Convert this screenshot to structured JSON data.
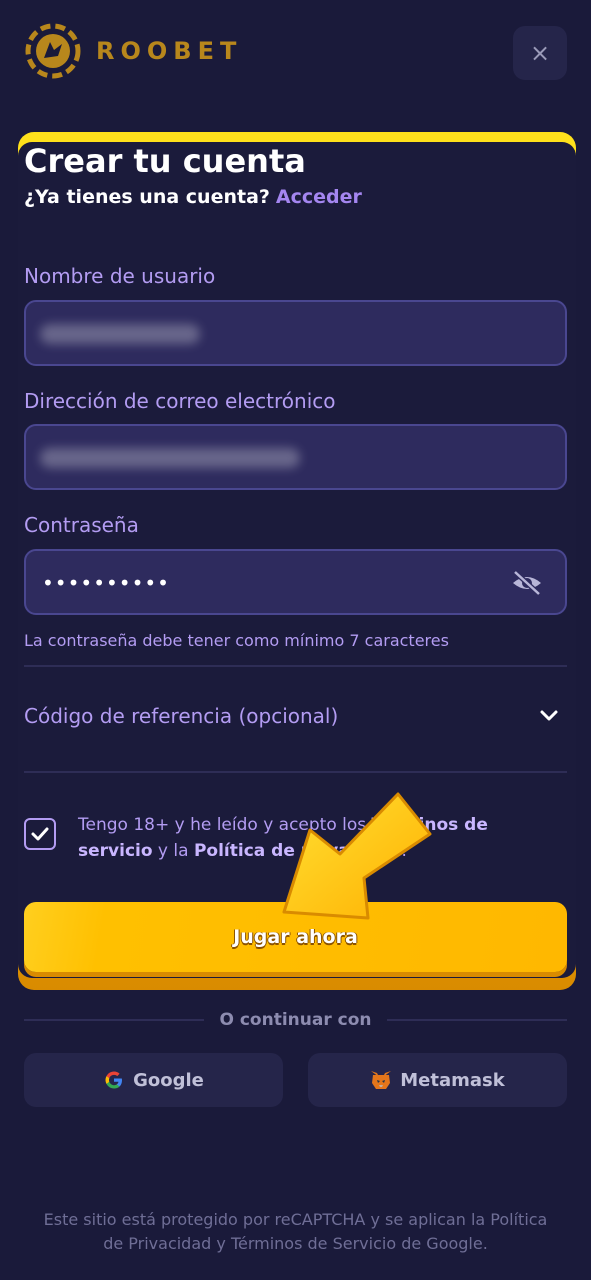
{
  "header": {
    "logo_text": "ROOBET",
    "close_icon": "×"
  },
  "form": {
    "title": "Crear tu cuenta",
    "have_account": "¿Ya tienes una cuenta?",
    "login_link": "Acceder",
    "username_label": "Nombre de usuario",
    "email_label": "Dirección de correo electrónico",
    "password_label": "Contraseña",
    "password_value": "••••••••••",
    "password_hint": "La contraseña debe tener como mínimo 7 caracteres",
    "referral_label": "Código de referencia (opcional)",
    "terms": {
      "part1": "Tengo 18+ y he leído y acepto los ",
      "tos": "Términos de servicio",
      "part2": " y la ",
      "privacy": "Política de privacidad",
      "part3": "."
    },
    "submit_label": "Jugar ahora"
  },
  "social": {
    "divider_text": "O continuar con",
    "google_label": "Google",
    "metamask_label": "Metamask"
  },
  "footer": {
    "line1": "Este sitio está protegido por reCAPTCHA y se aplican la Política",
    "line2": "de Privacidad y Términos de Servicio de Google."
  },
  "colors": {
    "background": "#1a1a3a",
    "accent_purple": "#a486f0",
    "label_purple": "#b39cf2",
    "button_yellow": "#ffbe00",
    "logo_gold": "#b8871c"
  }
}
